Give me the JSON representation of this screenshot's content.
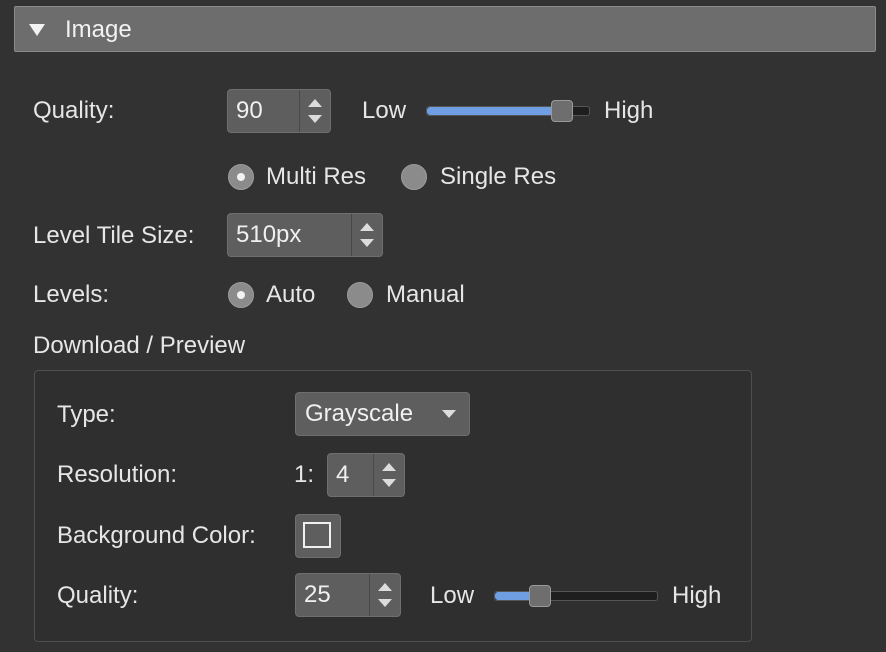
{
  "section": {
    "title": "Image",
    "icon": "disclosure-triangle-down-icon"
  },
  "quality": {
    "label": "Quality:",
    "value": "90",
    "low_label": "Low",
    "high_label": "High",
    "level": 0.85
  },
  "res_mode": {
    "options": [
      "Multi Res",
      "Single Res"
    ],
    "selected": "Multi Res"
  },
  "tile_size": {
    "label": "Level Tile Size:",
    "value": "510px"
  },
  "levels": {
    "label": "Levels:",
    "options": [
      "Auto",
      "Manual"
    ],
    "selected": "Auto"
  },
  "download": {
    "title": "Download / Preview",
    "type": {
      "label": "Type:",
      "value": "Grayscale"
    },
    "resolution": {
      "label": "Resolution:",
      "prefix": "1:",
      "value": "4"
    },
    "background": {
      "label": "Background Color:"
    },
    "quality": {
      "label": "Quality:",
      "value": "25",
      "low_label": "Low",
      "high_label": "High",
      "level": 0.25
    }
  },
  "colors": {
    "accent": "#6f9fe2",
    "background": "#323232",
    "header": "#6d6d6d"
  }
}
